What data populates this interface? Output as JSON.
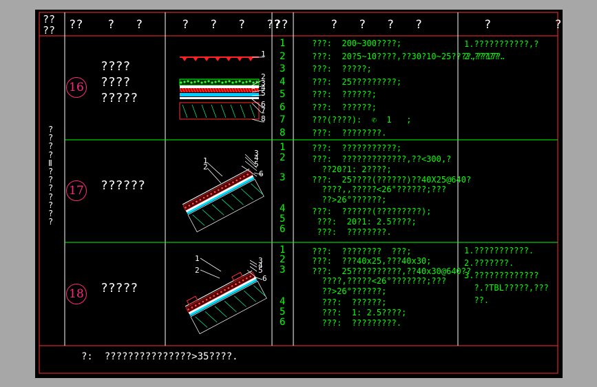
{
  "headers": [
    "??\n??",
    "??",
    "?   ?",
    "?   ?   ?   ??",
    "??",
    "?   ?   ?   ?",
    "?         ?"
  ],
  "category_label": [
    "?",
    "?",
    "?",
    "?",
    "Ⅱ",
    "?",
    "?",
    "?",
    "?",
    "?",
    "?",
    "?"
  ],
  "rows": [
    {
      "number": "16",
      "name_lines": [
        "????",
        "????",
        "?????"
      ],
      "layer_labels": [
        "1",
        "2",
        "3",
        "4",
        "5",
        "6",
        "7",
        "8"
      ],
      "seq": [
        "1",
        "2",
        "3",
        "4",
        "5",
        "6",
        "7",
        "8"
      ],
      "desc_lines": [
        "???:  200~300????;",
        "???:  20?5~10????,??30?10~25????,??17?.",
        "???:  ?????;",
        "???:  25?????????;",
        "???:  ??????;",
        "???:  ??????;",
        "???(????):  ✆  1   ;",
        "???:  ????????."
      ],
      "notes": [
        "1.???????????,?",
        "2.?????."
      ]
    },
    {
      "number": "17",
      "name_lines": [
        "??????"
      ],
      "layer_labels": [
        "1",
        "2",
        "3",
        "4",
        "5",
        "6"
      ],
      "seq": [
        "1",
        "2",
        "3",
        "4",
        "5",
        "6"
      ],
      "desc_lines": [
        "???:  ???????????;",
        "???:  ?????????????,??<300,?",
        "  ??20?1: 2????;",
        "???:  25????(??????)??40X25@640?",
        "  ????,,?????<26°??????;???",
        "  ??>26°??????;",
        "???:  ??????(?????????);",
        " ???:  20?1: 2.5????;",
        " ???:  ????????."
      ],
      "notes": []
    },
    {
      "number": "18",
      "name_lines": [
        "?????"
      ],
      "layer_labels": [
        "1",
        "2",
        "3",
        "4",
        "5",
        "6"
      ],
      "seq": [
        "1",
        "2",
        "3",
        "4",
        "5",
        "6"
      ],
      "desc_lines": [
        "???:  ????????  ???;",
        "???:  ???40x25,???40x30;",
        "???:  25??????????,??40x30@640??",
        "  ????,?????<26°???????;???",
        "  ??>26°??????;",
        "  ???:  ??????;",
        "  ???:  1: 2.5????;",
        "  ???:  ?????????."
      ],
      "notes": [
        "1.???????????.",
        "2.???????.",
        "3.?????????????",
        "  ?.?TBL?????,???",
        "  ??."
      ]
    }
  ],
  "footer": "?:  ???????????????>35????."
}
